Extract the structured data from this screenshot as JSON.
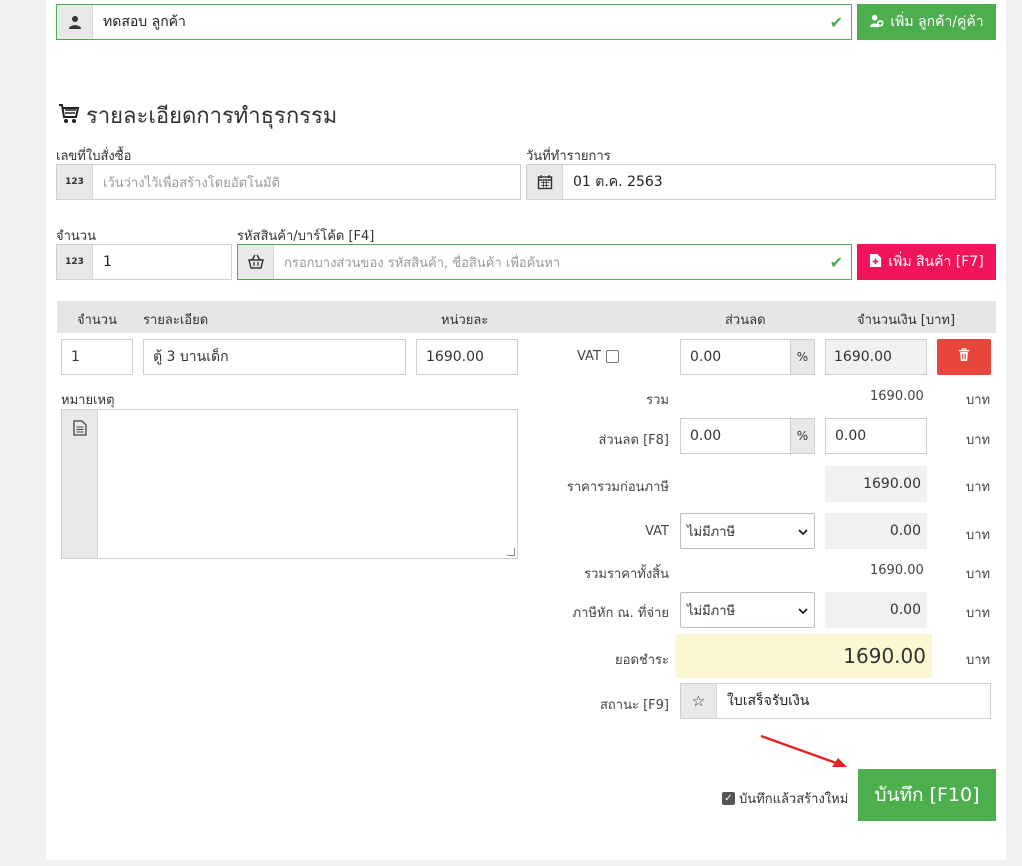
{
  "customer": {
    "value": "ทดสอบ ลูกค้า",
    "add_button": "เพิ่ม ลูกค้า/คู่ค้า"
  },
  "section_title": "รายละเอียดการทำธุรกรรม",
  "order_number": {
    "label": "เลขที่ใบสั่งซื้อ",
    "placeholder": "เว้นว่างไว้เพื่อสร้างโดยอัตโนมัติ"
  },
  "transaction_date": {
    "label": "วันที่ทำรายการ",
    "value": "01 ต.ค. 2563"
  },
  "quantity": {
    "label": "จำนวน",
    "value": "1"
  },
  "product_code": {
    "label": "รหัสสินค้า/บาร์โค้ด [F4]",
    "placeholder": "กรอกบางส่วนของ รหัสสินค้า, ชื่อสินค้า เพื่อค้นหา",
    "add_button": "เพิ่ม สินค้า [F7]"
  },
  "table": {
    "headers": [
      "จำนวน",
      "รายละเอียด",
      "หน่วยละ",
      "ส่วนลด",
      "จำนวนเงิน [บาท]"
    ],
    "row": {
      "qty": "1",
      "description": "ตู้ 3 บานเด็ก",
      "unit_price": "1690.00",
      "vat_label": "VAT",
      "discount": "0.00",
      "discount_unit": "%",
      "amount": "1690.00"
    }
  },
  "note": {
    "label": "หมายเหตุ"
  },
  "summary": {
    "total_label": "รวม",
    "total_value": "1690.00",
    "discount_label": "ส่วนลด [F8]",
    "discount_pct": "0.00",
    "discount_unit": "%",
    "discount_value": "0.00",
    "pretax_label": "ราคารวมก่อนภาษี",
    "pretax_value": "1690.00",
    "vat_label": "VAT",
    "vat_option": "ไม่มีภาษี",
    "vat_value": "0.00",
    "grand_label": "รวมราคาทั้งสิ้น",
    "grand_value": "1690.00",
    "wht_label": "ภาษีหัก ณ. ที่จ่าย",
    "wht_option": "ไม่มีภาษี",
    "wht_value": "0.00",
    "payable_label": "ยอดชำระ",
    "payable_value": "1690.00",
    "currency": "บาท"
  },
  "status": {
    "label": "สถานะ [F9]",
    "value": "ใบเสร็จรับเงิน"
  },
  "footer": {
    "save_new_label": "บันทึกแล้วสร้างใหม่",
    "save_button": "บันทึก [F10]"
  },
  "colors": {
    "green": "#4cae4c",
    "pink": "#f0145a",
    "red": "#e8463c",
    "highlight": "#fcf8d3"
  }
}
